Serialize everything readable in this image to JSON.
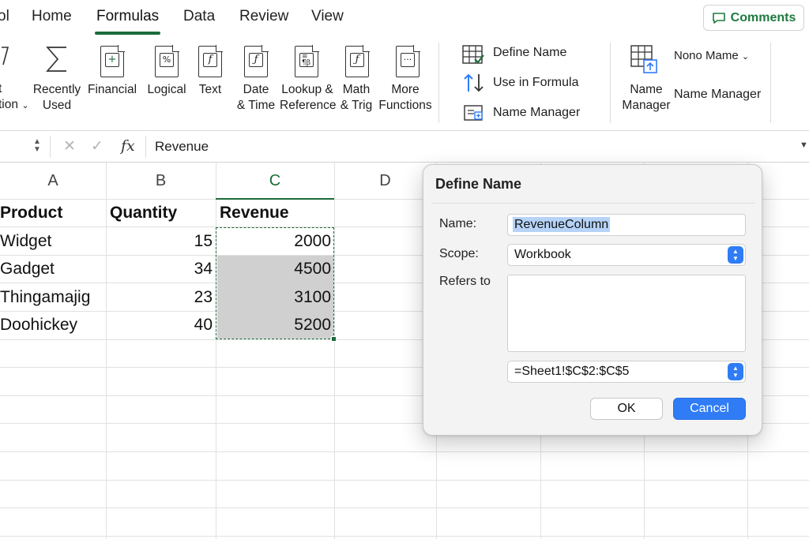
{
  "tabs": [
    {
      "label": "ol",
      "active": false
    },
    {
      "label": "Home",
      "active": false
    },
    {
      "label": "Formulas",
      "active": true
    },
    {
      "label": "Data",
      "active": false
    },
    {
      "label": "Review",
      "active": false
    },
    {
      "label": "View",
      "active": false
    }
  ],
  "comments_label": "Comments",
  "ribbon": {
    "insert_function_line1": "t",
    "insert_function_line2": "tion",
    "recently_used_line1": "Recently",
    "recently_used_line2": "Used",
    "financial": "Financial",
    "logical": "Logical",
    "text": "Text",
    "date_time_line1": "Date",
    "date_time_line2": "& Time",
    "lookup_line1": "Lookup &",
    "lookup_line2": "Reference",
    "math_line1": "Math",
    "math_line2": "& Trig",
    "more_line1": "More",
    "more_line2": "Functions",
    "define_name": "Define Name",
    "use_in_formula": "Use in Formula",
    "name_manager_small": "Name Manager",
    "name_manager_line1": "Name",
    "name_manager_line2": "Manager",
    "nono_mame": "Nono Mame",
    "name_manager_right": "Name Manager"
  },
  "formula_bar": {
    "fx": "fx",
    "value": "Revenue"
  },
  "columns": [
    "A",
    "B",
    "C",
    "D"
  ],
  "table": {
    "headers": [
      "Product",
      "Quantity",
      "Revenue"
    ],
    "rows": [
      {
        "product": "Widget",
        "quantity": "15",
        "revenue": "2000"
      },
      {
        "product": "Gadget",
        "quantity": "34",
        "revenue": "4500"
      },
      {
        "product": "Thingamajig",
        "quantity": "23",
        "revenue": "3100"
      },
      {
        "product": "Doohickey",
        "quantity": "40",
        "revenue": "5200"
      }
    ]
  },
  "dialog": {
    "title": "Define Name",
    "name_label": "Name:",
    "name_value": "RevenueColumn",
    "scope_label": "Scope:",
    "scope_value": "Workbook",
    "refers_label": "Refers to",
    "refers_value": "=Sheet1!$C$2:$C$5",
    "ok_label": "OK",
    "cancel_label": "Cancel"
  },
  "colors": {
    "accent_green": "#1b6b3a",
    "button_blue": "#2f7cf6"
  }
}
